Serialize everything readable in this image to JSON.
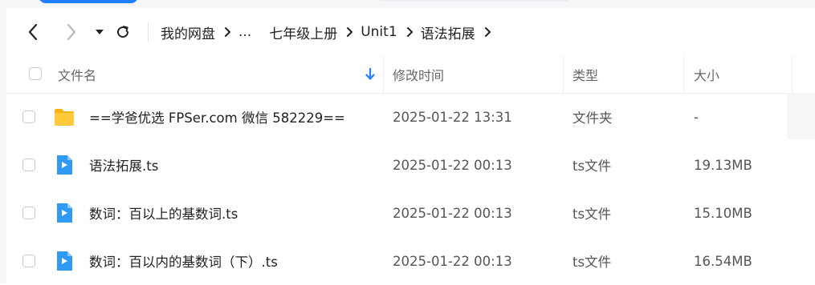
{
  "nav": {
    "back_icon": "chevron-left-icon",
    "forward_icon": "chevron-right-icon",
    "dropdown_icon": "caret-down-icon",
    "refresh_icon": "refresh-icon"
  },
  "breadcrumb": {
    "items": [
      "我的网盘",
      "...",
      "七年级上册",
      "Unit1",
      "语法拓展"
    ],
    "separator_icon": "chevron-right-icon"
  },
  "table": {
    "headers": {
      "name": "文件名",
      "modified": "修改时间",
      "type": "类型",
      "size": "大小"
    },
    "sort_icon": "arrow-down-icon",
    "accent": "#1f80ff",
    "rows": [
      {
        "name": "==学爸优选 FPSer.com 微信 582229==",
        "modified": "2025-01-22 13:31",
        "type": "文件夹",
        "size": "-",
        "icon": "folder-icon"
      },
      {
        "name": "语法拓展.ts",
        "modified": "2025-01-22 00:13",
        "type": "ts文件",
        "size": "19.13MB",
        "icon": "video-file-icon"
      },
      {
        "name": "数词：百以上的基数词.ts",
        "modified": "2025-01-22 00:13",
        "type": "ts文件",
        "size": "15.10MB",
        "icon": "video-file-icon"
      },
      {
        "name": "数词：百以内的基数词（下）.ts",
        "modified": "2025-01-22 00:13",
        "type": "ts文件",
        "size": "16.54MB",
        "icon": "video-file-icon"
      }
    ]
  }
}
